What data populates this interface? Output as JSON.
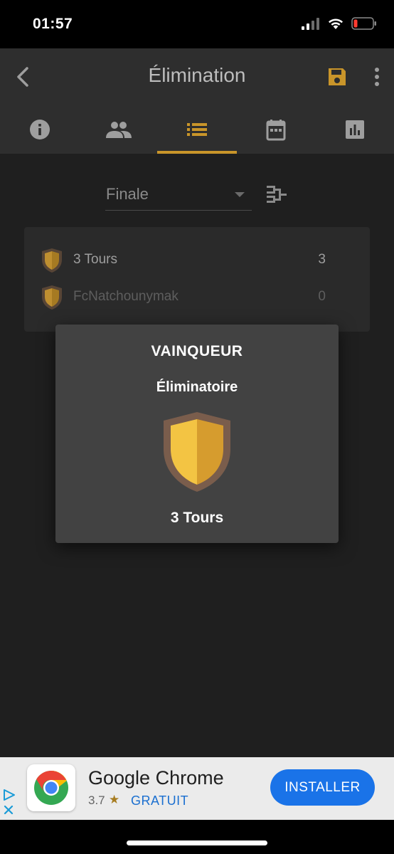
{
  "status_bar": {
    "time": "01:57"
  },
  "app_bar": {
    "title": "Élimination"
  },
  "tabs": [
    {
      "id": "info",
      "icon": "info-icon"
    },
    {
      "id": "players",
      "icon": "people-icon"
    },
    {
      "id": "matches",
      "icon": "list-icon",
      "selected": true
    },
    {
      "id": "calendar",
      "icon": "calendar-icon"
    },
    {
      "id": "stats",
      "icon": "bar-chart-icon"
    }
  ],
  "round_selector": {
    "value": "Finale"
  },
  "match": {
    "teams": [
      {
        "name": "3 Tours",
        "score": "3"
      },
      {
        "name": "FcNatchounymak",
        "score": "0"
      }
    ]
  },
  "winner_dialog": {
    "title": "VAINQUEUR",
    "subtitle": "Éliminatoire",
    "team": "3 Tours"
  },
  "ad": {
    "app_name": "Google Chrome",
    "rating": "3.7",
    "star": "★",
    "price": "GRATUIT",
    "install_label": "INSTALLER"
  },
  "colors": {
    "accent": "#c9952a",
    "shield_gold": "#f3c443",
    "shield_dark_gold": "#d69c2e",
    "shield_border": "#7a5d4c"
  }
}
